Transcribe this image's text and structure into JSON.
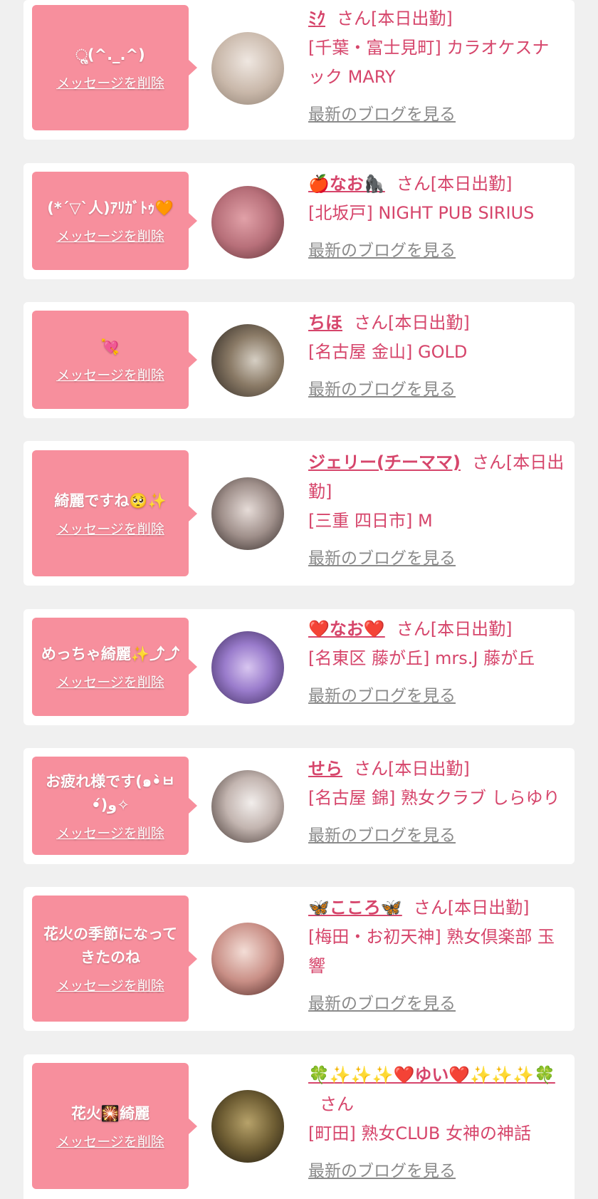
{
  "entries": [
    {
      "message": "ૢ(^._.^)",
      "delete_label": "メッセージを削除",
      "name": "ﾐｸ",
      "san_status": "さん[本日出勤]",
      "shop": "[千葉・富士見町] カラオケスナック MARY",
      "blog_label": "最新のブログを見る",
      "avatar_colors": [
        "#e9e2dc",
        "#b9a99c"
      ]
    },
    {
      "message": "(*´▽`人)ｱﾘｶﾞﾄｩ🧡",
      "delete_label": "メッセージを削除",
      "name": "🍎なお🦍",
      "san_status": "さん[本日出勤]",
      "shop": "[北坂戸] NIGHT PUB SIRIUS",
      "blog_label": "最新のブログを見る",
      "avatar_colors": [
        "#c97b84",
        "#6b3b3f"
      ]
    },
    {
      "message": "💘",
      "delete_label": "メッセージを削除",
      "name": "ちほ",
      "san_status": "さん[本日出勤]",
      "shop": "[名古屋 金山] GOLD",
      "blog_label": "最新のブログを見る",
      "avatar_colors": [
        "#8a7a66",
        "#2f2a26"
      ]
    },
    {
      "message": "綺麗ですね🥺✨",
      "delete_label": "メッセージを削除",
      "name": "ジェリー(チーママ)",
      "san_status": "さん[本日出勤]",
      "shop": "[三重 四日市] M",
      "blog_label": "最新のブログを見る",
      "avatar_colors": [
        "#b8a9a3",
        "#3a2f2c"
      ]
    },
    {
      "message": "めっちゃ綺麗✨⤴⤴",
      "delete_label": "メッセージを削除",
      "name": "❤️なお❤️",
      "san_status": "さん[本日出勤]",
      "shop": "[名東区 藤が丘] mrs.J 藤が丘",
      "blog_label": "最新のブログを見る",
      "avatar_colors": [
        "#a58bd6",
        "#3d2d5a"
      ]
    },
    {
      "message": "お疲れ様です(๑•̀ㅂ•́)و✧",
      "delete_label": "メッセージを削除",
      "name": "せら",
      "san_status": "さん[本日出勤]",
      "shop": "[名古屋 錦] 熟女クラブ しらゆり",
      "blog_label": "最新のブログを見る",
      "avatar_colors": [
        "#d9d4d2",
        "#4a3c38"
      ]
    },
    {
      "message": "花火の季節になってきたのね",
      "delete_label": "メッセージを削除",
      "name": "🦋こころ🦋",
      "san_status": "さん[本日出勤]",
      "shop": "[梅田・お初天神] 熟女倶楽部 玉響",
      "blog_label": "最新のブログを見る",
      "avatar_colors": [
        "#e8c8bf",
        "#6a3a34"
      ]
    },
    {
      "message": "花火🎇綺麗",
      "delete_label": "メッセージを削除",
      "name": "🍀✨✨✨❤️ゆい❤️✨✨✨🍀",
      "san_status": "さん",
      "shop": "[町田] 熟女CLUB 女神の神話",
      "blog_label": "最新のブログを見る",
      "avatar_colors": [
        "#7a6a3a",
        "#1f1a12"
      ]
    }
  ]
}
